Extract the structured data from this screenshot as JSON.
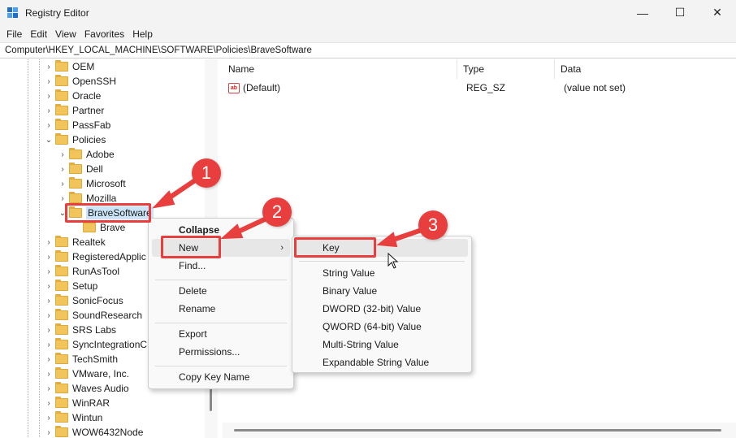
{
  "window": {
    "title": "Registry Editor",
    "minimize": "—",
    "maximize": "☐",
    "close": "✕"
  },
  "menubar": [
    "File",
    "Edit",
    "View",
    "Favorites",
    "Help"
  ],
  "address": "Computer\\HKEY_LOCAL_MACHINE\\SOFTWARE\\Policies\\BraveSoftware",
  "tree": [
    {
      "label": "OEM",
      "chevron": ">"
    },
    {
      "label": "OpenSSH",
      "chevron": ">"
    },
    {
      "label": "Oracle",
      "chevron": ">"
    },
    {
      "label": "Partner",
      "chevron": ">"
    },
    {
      "label": "PassFab",
      "chevron": ">"
    },
    {
      "label": "Policies",
      "chevron": "v"
    },
    {
      "label": "Adobe",
      "chevron": ">"
    },
    {
      "label": "Dell",
      "chevron": ">"
    },
    {
      "label": "Microsoft",
      "chevron": ">"
    },
    {
      "label": "Mozilla",
      "chevron": ">"
    },
    {
      "label": "BraveSoftware",
      "chevron": "v"
    },
    {
      "label": "Brave",
      "chevron": ""
    },
    {
      "label": "Realtek",
      "chevron": ">"
    },
    {
      "label": "RegisteredApplic",
      "chevron": ">"
    },
    {
      "label": "RunAsTool",
      "chevron": ">"
    },
    {
      "label": "Setup",
      "chevron": ">"
    },
    {
      "label": "SonicFocus",
      "chevron": ">"
    },
    {
      "label": "SoundResearch",
      "chevron": ">"
    },
    {
      "label": "SRS Labs",
      "chevron": ">"
    },
    {
      "label": "SyncIntegrationC",
      "chevron": ">"
    },
    {
      "label": "TechSmith",
      "chevron": ">"
    },
    {
      "label": "VMware, Inc.",
      "chevron": ">"
    },
    {
      "label": "Waves Audio",
      "chevron": ">"
    },
    {
      "label": "WinRAR",
      "chevron": ">"
    },
    {
      "label": "Wintun",
      "chevron": ">"
    },
    {
      "label": "WOW6432Node",
      "chevron": ">"
    }
  ],
  "list": {
    "columns": [
      "Name",
      "Type",
      "Data"
    ],
    "rows": [
      {
        "icon": "ab",
        "name": "(Default)",
        "type": "REG_SZ",
        "data": "(value not set)"
      }
    ]
  },
  "context_menu": [
    "Collapse",
    "New",
    "Find...",
    "Delete",
    "Rename",
    "Export",
    "Permissions...",
    "Copy Key Name"
  ],
  "new_submenu": [
    "Key",
    "String Value",
    "Binary Value",
    "DWORD (32-bit) Value",
    "QWORD (64-bit) Value",
    "Multi-String Value",
    "Expandable String Value"
  ],
  "callouts": [
    "1",
    "2",
    "3"
  ],
  "colors": {
    "accent_red": "#e83e3e",
    "folder": "#f2c55c",
    "selection": "#cce4f7"
  }
}
